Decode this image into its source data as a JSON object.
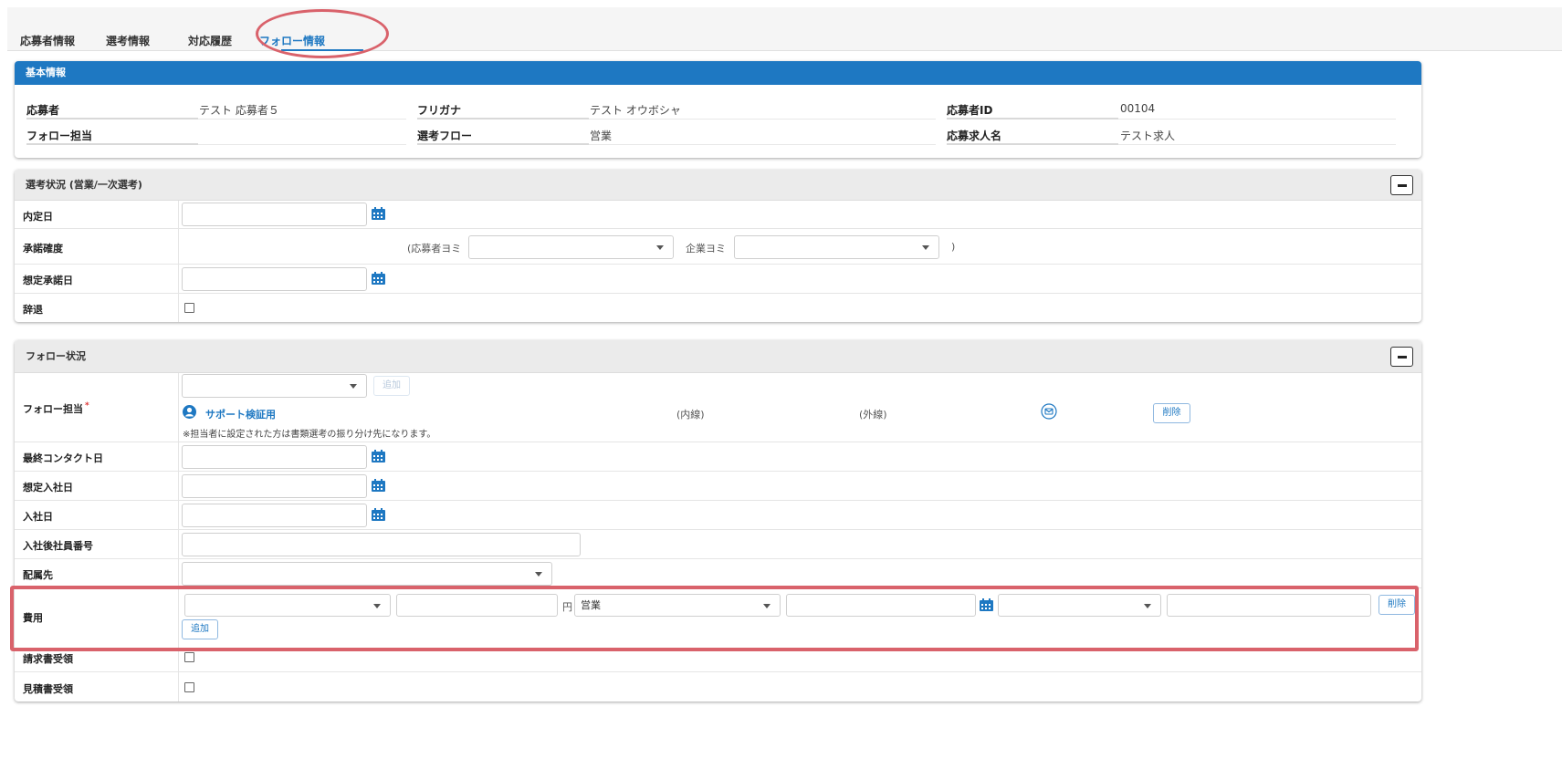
{
  "tabs": [
    {
      "label": "応募者情報"
    },
    {
      "label": "選考情報"
    },
    {
      "label": "対応履歴"
    },
    {
      "label": "フォロー情報"
    }
  ],
  "basic": {
    "title": "基本情報",
    "applicant_label": "応募者",
    "applicant_value": "テスト 応募者５",
    "furigana_label": "フリガナ",
    "furigana_value": "テスト オウボシャ",
    "id_label": "応募者ID",
    "id_value": "00104",
    "follow_label": "フォロー担当",
    "follow_value": "",
    "flow_label": "選考フロー",
    "flow_value": "営業",
    "job_label": "応募求人名",
    "job_value": "テスト求人"
  },
  "selection": {
    "title": "選考状況 (営業/一次選考)",
    "offer_date_label": "内定日",
    "acceptance_label": "承諾確度",
    "applicant_yomi_prefix": "(応募者ヨミ",
    "company_yomi_label": "企業ヨミ",
    "paren_close": ")",
    "expected_accept_label": "想定承諾日",
    "decline_label": "辞退"
  },
  "follow": {
    "title": "フォロー状況",
    "owner_label": "フォロー担当",
    "required_mark": "*",
    "add_label": "追加",
    "person_name": "サポート検証用",
    "ext_internal": "(内線)",
    "ext_external": "(外線)",
    "delete_label": "削除",
    "note": "※担当者に設定された方は書類選考の振り分け先になります。",
    "last_contact_label": "最終コンタクト日",
    "expected_join_label": "想定入社日",
    "join_label": "入社日",
    "employee_no_label": "入社後社員番号",
    "assign_label": "配属先",
    "cost_label": "費用",
    "yen_label": "円",
    "cost_category_value": "営業",
    "cost_delete_label": "削除",
    "cost_add_label": "追加",
    "invoice_label": "請求書受領",
    "estimate_label": "見積書受領"
  },
  "colors": {
    "accent": "#1e78c2",
    "highlight": "#d9626b"
  },
  "icons": [
    "calendar-icon",
    "person-icon",
    "mail-icon",
    "minus-icon",
    "chevron-down-icon"
  ]
}
